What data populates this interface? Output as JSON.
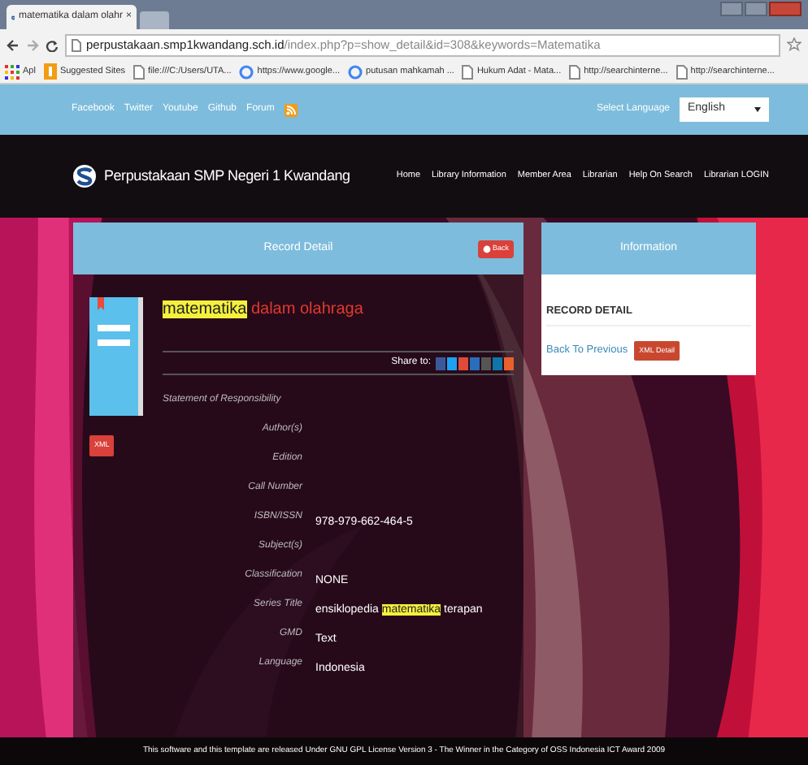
{
  "browser": {
    "tab": {
      "title": "matematika dalam olahr",
      "close": "×"
    },
    "url": {
      "host": "perpustakaan.smp1kwandang.sch.id",
      "path": "/index.php?p=show_detail&id=308&keywords=Matematika"
    },
    "bookmarks": [
      {
        "label": "Apl",
        "kind": "apps"
      },
      {
        "label": "Suggested Sites",
        "kind": "suggested"
      },
      {
        "label": "file:///C:/Users/UTA...",
        "kind": "page"
      },
      {
        "label": "https://www.google...",
        "kind": "google"
      },
      {
        "label": "putusan mahkamah ...",
        "kind": "google"
      },
      {
        "label": "Hukum Adat - Mata...",
        "kind": "page"
      },
      {
        "label": "http://searchinterne...",
        "kind": "page"
      },
      {
        "label": "http://searchinterne...",
        "kind": "page"
      }
    ]
  },
  "topbar": {
    "links": [
      "Facebook",
      "Twitter",
      "Youtube",
      "Github",
      "Forum"
    ],
    "language_label": "Select Language",
    "language": "English"
  },
  "header": {
    "site_title": "Perpustakaan SMP Negeri 1 Kwandang",
    "nav": [
      "Home",
      "Library Information",
      "Member Area",
      "Librarian",
      "Help On Search",
      "Librarian LOGIN"
    ]
  },
  "record": {
    "heading": "Record Detail",
    "back_button": "Back",
    "xml_badge": "XML",
    "title": [
      {
        "text": "matematika",
        "highlighted": true
      },
      {
        "text": " dalam olahraga",
        "highlighted": false
      }
    ],
    "share_label": "Share to:",
    "share_icons": [
      {
        "color": "#3b5998"
      },
      {
        "color": "#1da1f2"
      },
      {
        "color": "#dd4b39"
      },
      {
        "color": "#2a6ebb"
      },
      {
        "color": "#555555"
      },
      {
        "color": "#0e76a8"
      },
      {
        "color": "#e8612c"
      }
    ],
    "fields": [
      {
        "label": "Statement of Responsibility"
      },
      {
        "label": "Author(s)"
      },
      {
        "label": "Edition"
      },
      {
        "label": "Call Number"
      },
      {
        "label": "ISBN/ISSN",
        "value": [
          {
            "text": "978-979-662-464-5",
            "highlighted": false
          }
        ]
      },
      {
        "label": "Subject(s)"
      },
      {
        "label": "Classification",
        "value": [
          {
            "text": "NONE",
            "highlighted": false
          }
        ]
      },
      {
        "label": "Series Title",
        "value": [
          {
            "text": "ensiklopedia ",
            "highlighted": false
          },
          {
            "text": "matematika",
            "highlighted": true
          },
          {
            "text": " terapan",
            "highlighted": false
          }
        ]
      },
      {
        "label": "GMD",
        "value": [
          {
            "text": "Text",
            "highlighted": false
          }
        ]
      },
      {
        "label": "Language",
        "value": [
          {
            "text": "Indonesia",
            "highlighted": false
          }
        ]
      }
    ]
  },
  "info": {
    "heading": "Information",
    "text": "RECORD DETAIL",
    "back_link": "Back To Previous",
    "xml_button": "XML Detail"
  },
  "footer": "This software and this template are released Under GNU GPL License Version 3 - The Winner in the Category of OSS Indonesia ICT Award 2009"
}
